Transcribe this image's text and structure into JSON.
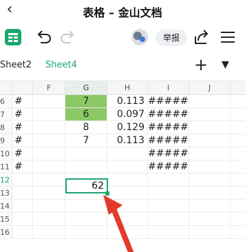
{
  "title": "表格 – 金山文档",
  "toolbar": {
    "report_label": "举报"
  },
  "tabs": [
    {
      "label": "Sheet2"
    },
    {
      "label": "Sheet4"
    }
  ],
  "colors": {
    "accent": "#1aa66c",
    "highlight": "#8cc865",
    "arrow": "#e23b2e"
  },
  "columns": [
    "F",
    "G",
    "H",
    "I",
    "J"
  ],
  "rows": [
    {
      "num": "6",
      "e": "#",
      "g": "7",
      "h": "0.113",
      "i": "#####"
    },
    {
      "num": "7",
      "e": "#",
      "g": "6",
      "h": "0.097",
      "i": "#####"
    },
    {
      "num": "8",
      "e": "#",
      "g": "8",
      "h": "0.129",
      "i": "#####"
    },
    {
      "num": "9",
      "e": "#",
      "g": "7",
      "h": "0.113",
      "i": "#####"
    },
    {
      "num": "10",
      "e": "#",
      "g": "",
      "h": "",
      "i": "#####"
    },
    {
      "num": "11",
      "e": "#",
      "g": "",
      "h": "",
      "i": "#####"
    },
    {
      "num": "12",
      "e": "",
      "g": "62",
      "h": "",
      "i": ""
    },
    {
      "num": "13",
      "e": "",
      "g": "",
      "h": "",
      "i": ""
    },
    {
      "num": "14",
      "e": "",
      "g": "",
      "h": "",
      "i": ""
    },
    {
      "num": "15",
      "e": "",
      "g": "",
      "h": "",
      "i": ""
    },
    {
      "num": "16",
      "e": "",
      "g": "",
      "h": "",
      "i": ""
    }
  ]
}
